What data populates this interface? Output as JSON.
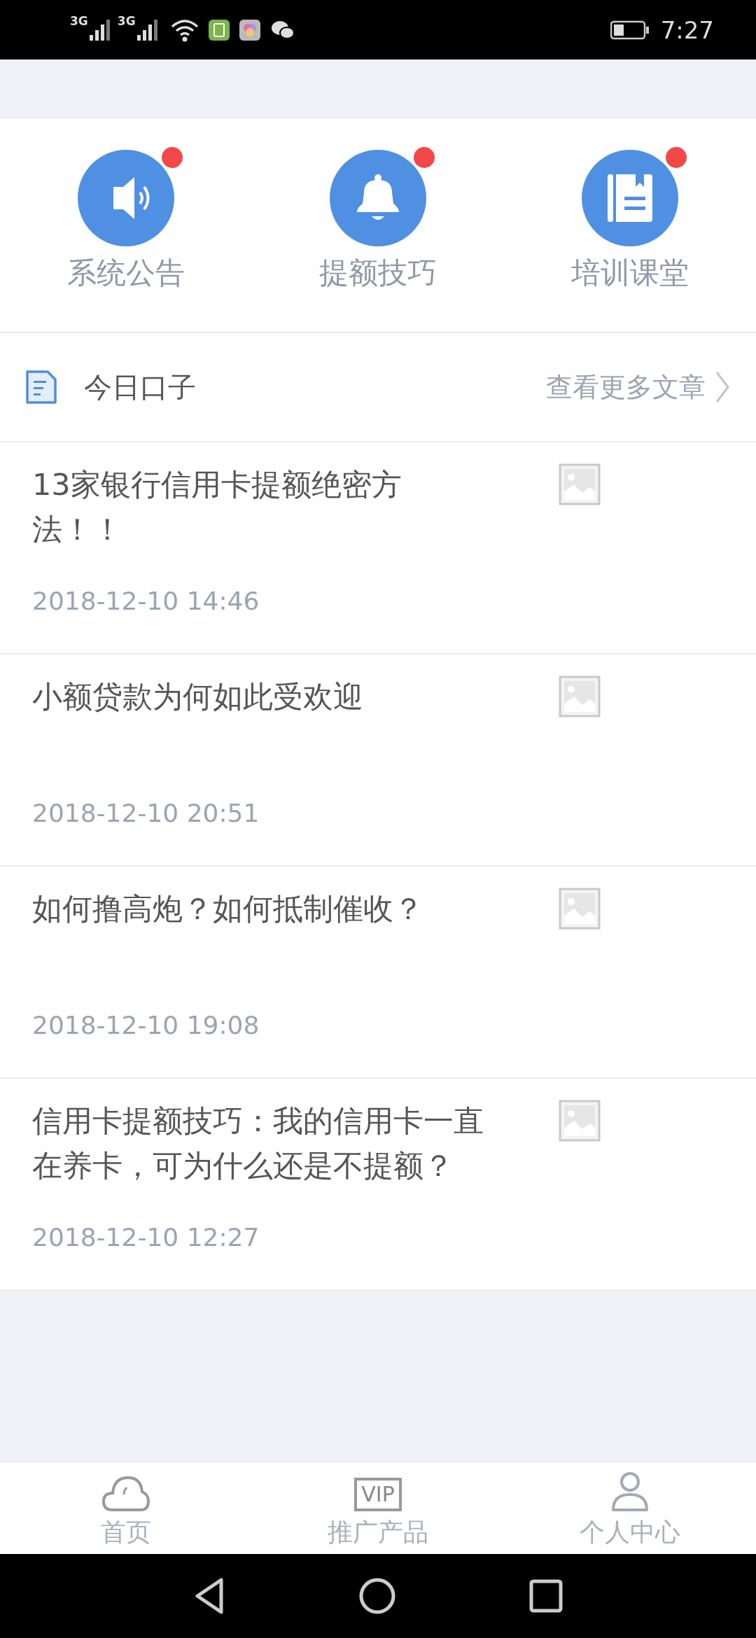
{
  "status_bar": {
    "signals": [
      {
        "network": "3G"
      },
      {
        "network": "3G"
      }
    ],
    "time": "7:27"
  },
  "shortcuts": [
    {
      "kind": "speaker",
      "label": "系统公告",
      "badge": true
    },
    {
      "kind": "bell",
      "label": "提额技巧",
      "badge": true
    },
    {
      "kind": "book",
      "label": "培训课堂",
      "badge": true
    }
  ],
  "section": {
    "title": "今日口子",
    "more": "查看更多文章"
  },
  "articles": [
    {
      "title": "13家银行信用卡提额绝密方法！！",
      "date": "2018-12-10 14:46"
    },
    {
      "title": "小额贷款为何如此受欢迎",
      "date": "2018-12-10 20:51"
    },
    {
      "title": "如何撸高炮？如何抵制催收？",
      "date": "2018-12-10 19:08"
    },
    {
      "title": "信用卡提额技巧：我的信用卡一直在养卡，可为什么还是不提额？",
      "date": "2018-12-10 12:27"
    }
  ],
  "bottom_nav": [
    {
      "kind": "cloud",
      "label": "首页"
    },
    {
      "kind": "vip",
      "label": "推广产品",
      "badge_text": "VIP"
    },
    {
      "kind": "person",
      "label": "个人中心"
    }
  ]
}
